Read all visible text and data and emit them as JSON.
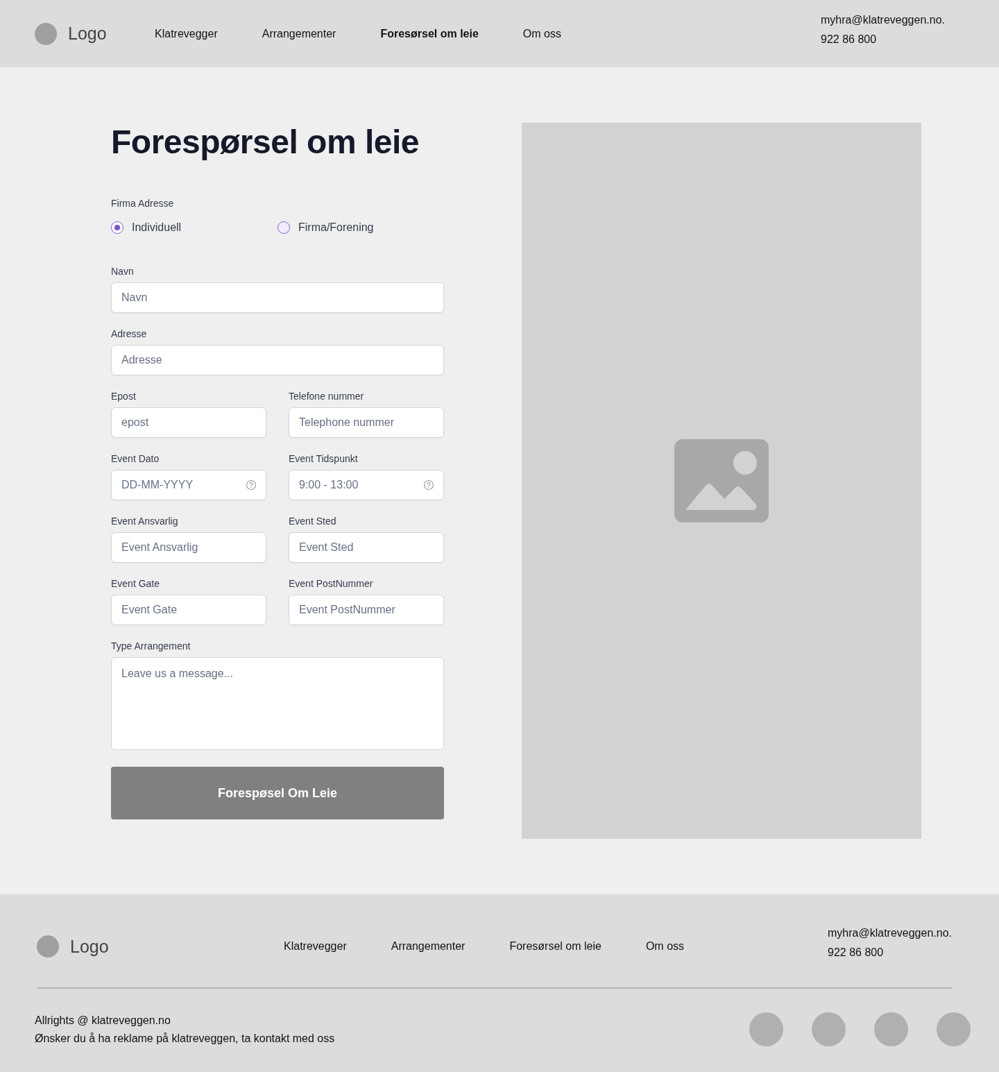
{
  "header": {
    "logo": "Logo",
    "nav": [
      {
        "label": "Klatrevegger",
        "selected": false
      },
      {
        "label": "Arrangementer",
        "selected": false
      },
      {
        "label": "Foresørsel om leie",
        "selected": true
      },
      {
        "label": "Om oss",
        "selected": false
      }
    ],
    "email": "myhra@klatreveggen.no.",
    "phone": "922 86 800"
  },
  "form": {
    "title": "Forespørsel om leie",
    "radio_label": "Firma Adresse",
    "radios": [
      {
        "label": "Individuell",
        "selected": true
      },
      {
        "label": "Firma/Forening",
        "selected": false
      }
    ],
    "rows": [
      [
        {
          "label": "Navn",
          "placeholder": "Navn",
          "kind": "input"
        }
      ],
      [
        {
          "label": "Adresse",
          "placeholder": "Adresse",
          "kind": "input"
        }
      ],
      [
        {
          "label": "Epost",
          "placeholder": "epost",
          "kind": "input"
        },
        {
          "label": "Telefone nummer",
          "placeholder": "Telephone nummer",
          "kind": "input"
        }
      ],
      [
        {
          "label": "Event Dato",
          "placeholder": "DD-MM-YYYY",
          "kind": "help"
        },
        {
          "label": "Event Tidspunkt",
          "placeholder": "9:00 - 13:00",
          "kind": "help"
        }
      ],
      [
        {
          "label": "Event Ansvarlig",
          "placeholder": "Event Ansvarlig",
          "kind": "input"
        },
        {
          "label": "Event Sted",
          "placeholder": "Event Sted",
          "kind": "input"
        }
      ],
      [
        {
          "label": "Event Gate",
          "placeholder": "Event Gate",
          "kind": "input"
        },
        {
          "label": "Event PostNummer",
          "placeholder": "Event PostNummer",
          "kind": "input"
        }
      ],
      [
        {
          "label": "Type Arrangement",
          "placeholder": "Leave us a message...",
          "kind": "textarea"
        }
      ]
    ],
    "submit": "Forespøsel Om Leie"
  },
  "footer": {
    "logo": "Logo",
    "nav": [
      "Klatrevegger",
      "Arrangementer",
      "Foresørsel om leie",
      "Om oss"
    ],
    "email": "myhra@klatreveggen.no.",
    "phone": "922 86 800",
    "copyright": "Allrights @ klatreveggen.no",
    "ad_text": "Ønsker du å ha reklame på klatreveggen, ta kontakt med oss"
  }
}
